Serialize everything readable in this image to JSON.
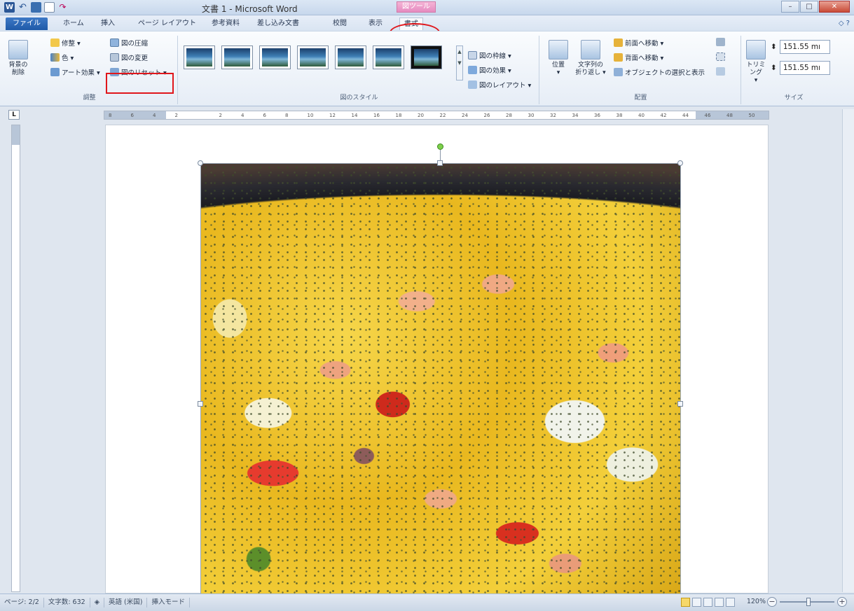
{
  "window": {
    "title": "文書 1 - Microsoft Word",
    "context_tool_label": "図ツール",
    "qat": {
      "word_icon": "W",
      "undo_icon": "↶",
      "redo_icon": "↷"
    },
    "controls": {
      "minimize": "–",
      "maximize": "□",
      "close": "✕"
    }
  },
  "tabs": [
    {
      "label": "ファイル"
    },
    {
      "label": "ホーム"
    },
    {
      "label": "挿入"
    },
    {
      "label": "ページ レイアウト"
    },
    {
      "label": "参考資料"
    },
    {
      "label": "差し込み文書"
    },
    {
      "label": "校閲"
    },
    {
      "label": "表示"
    },
    {
      "label": "書式"
    }
  ],
  "help_icon": "◇ ?",
  "ribbon": {
    "adjust": {
      "group_label": "調整",
      "remove_background": "背景の\n削除",
      "corrections": "修整 ▾",
      "color": "色 ▾",
      "art_effects": "アート効果 ▾",
      "compress": "図の圧縮",
      "change_picture": "図の変更",
      "reset_picture": "図のリセット ▾"
    },
    "styles": {
      "group_label": "図のスタイル",
      "border": "図の枠線 ▾",
      "effects": "図の効果 ▾",
      "layout": "図のレイアウト ▾"
    },
    "arrange": {
      "group_label": "配置",
      "position": "位置\n▾",
      "wrap_text": "文字列の\n折り返し ▾",
      "bring_forward": "前面へ移動 ▾",
      "send_backward": "背面へ移動 ▾",
      "selection_pane": "オブジェクトの選択と表示"
    },
    "size": {
      "group_label": "サイズ",
      "crop": "トリミング\n▾",
      "height": "151.55 mı",
      "width": "151.55 mı",
      "spin_icon": "⬍"
    }
  },
  "ruler": {
    "corner": "L",
    "ticks": [
      "8",
      "6",
      "4",
      "2",
      "",
      "2",
      "4",
      "6",
      "8",
      "10",
      "12",
      "14",
      "16",
      "18",
      "20",
      "22",
      "24",
      "26",
      "28",
      "30",
      "32",
      "34",
      "36",
      "38",
      "40",
      "42",
      "44",
      "46",
      "48",
      "50"
    ]
  },
  "status": {
    "page": "ページ: 2/2",
    "word_count": "文字数: 632",
    "language": "英語 (米国)",
    "mode": "挿入モード",
    "zoom": "120%",
    "zoom_minus": "−",
    "zoom_plus": "+"
  },
  "colors": {
    "file_tab": "#1f5aa8",
    "annotation_red": "#e0161b",
    "context_tab": "#e58ac0"
  }
}
